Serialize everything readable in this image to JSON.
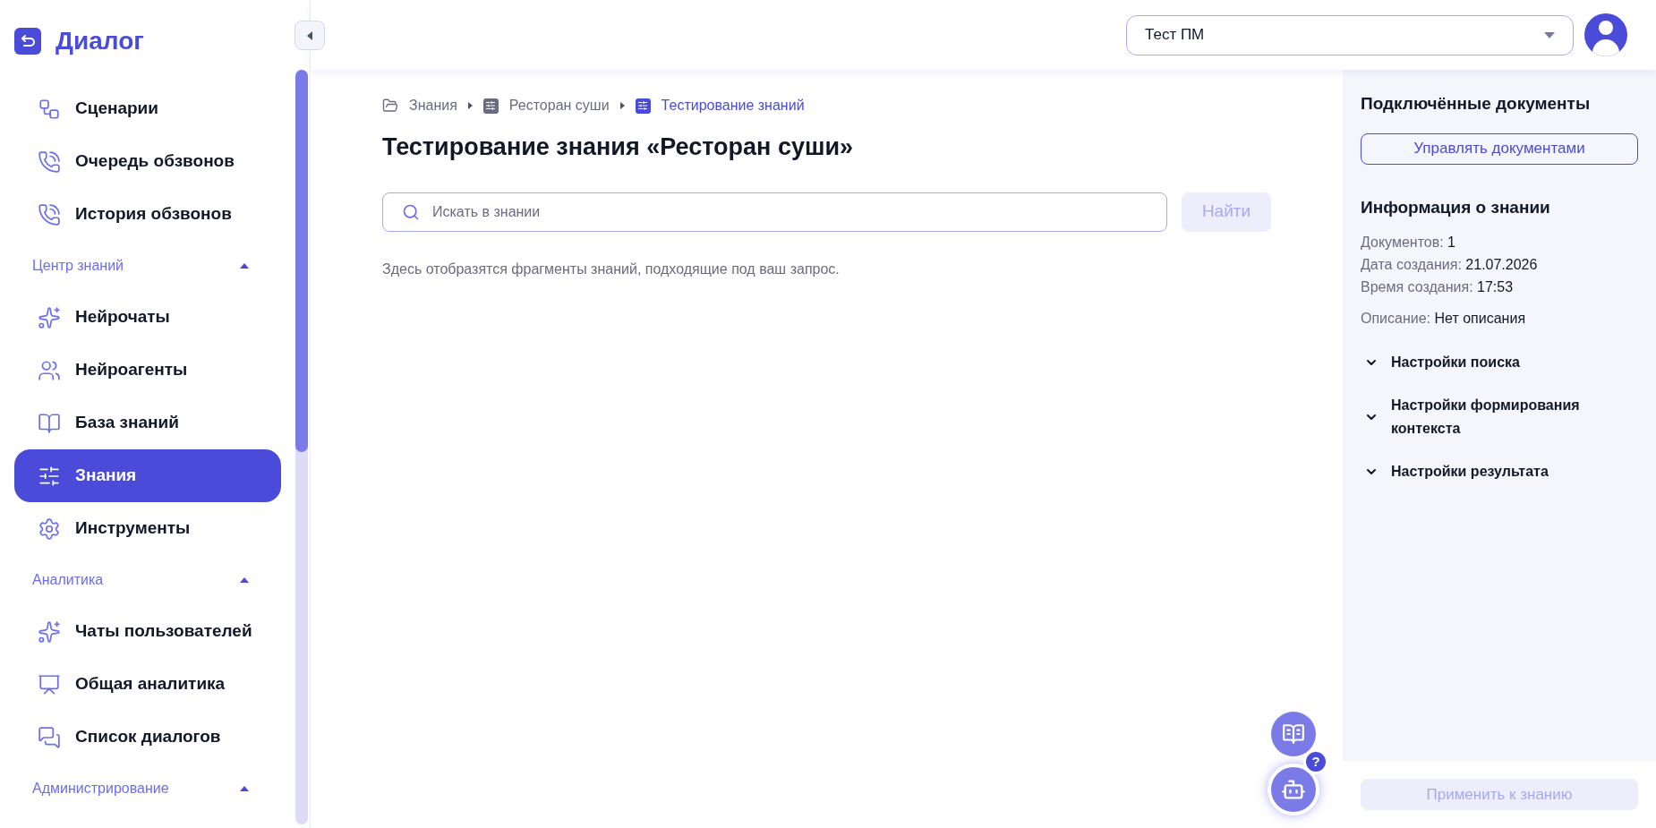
{
  "logo": {
    "text": "Диалог"
  },
  "sidebar": {
    "items": [
      {
        "kind": "item",
        "label": "Сценарии",
        "selected": false
      },
      {
        "kind": "item",
        "label": "Очередь обзвонов",
        "selected": false
      },
      {
        "kind": "item",
        "label": "История обзвонов",
        "selected": false
      },
      {
        "kind": "header",
        "label": "Центр знаний",
        "expanded": true
      },
      {
        "kind": "item",
        "label": "Нейрочаты",
        "selected": false
      },
      {
        "kind": "item",
        "label": "Нейроагенты",
        "selected": false
      },
      {
        "kind": "item",
        "label": "База знаний",
        "selected": false
      },
      {
        "kind": "item",
        "label": "Знания",
        "selected": true
      },
      {
        "kind": "item",
        "label": "Инструменты",
        "selected": false
      },
      {
        "kind": "header",
        "label": "Аналитика",
        "expanded": true
      },
      {
        "kind": "item",
        "label": "Чаты пользователей",
        "selected": false
      },
      {
        "kind": "item",
        "label": "Общая аналитика",
        "selected": false
      },
      {
        "kind": "item",
        "label": "Список диалогов",
        "selected": false
      },
      {
        "kind": "header",
        "label": "Администрирование",
        "expanded": true
      }
    ]
  },
  "header": {
    "project_select": {
      "value": "Тест ПМ"
    }
  },
  "breadcrumbs": [
    {
      "label": "Знания",
      "selected": false
    },
    {
      "label": "Ресторан суши",
      "selected": false
    },
    {
      "label": "Тестирование знаний",
      "selected": true
    }
  ],
  "page_title": "Тестирование знания «Ресторан суши»",
  "search": {
    "placeholder": "Искать в знании",
    "button": {
      "label": "Найти",
      "disabled": true
    }
  },
  "hint": "Здесь отобразятся фрагменты знаний, подходящие под ваш запрос.",
  "right_panel": {
    "documents_title": "Подключённые документы",
    "manage_button": "Управлять документами",
    "info_title": "Информация о знании",
    "info": [
      {
        "label": "Документов:",
        "value": "1"
      },
      {
        "label": "Дата создания:",
        "value": "21.07.2026"
      },
      {
        "label": "Время создания:",
        "value": "17:53"
      },
      {
        "label": "Описание:",
        "value": "Нет описания"
      }
    ],
    "sections": [
      {
        "label": "Настройки поиска",
        "expanded": false
      },
      {
        "label": "Настройки формирования контекста",
        "expanded": false
      },
      {
        "label": "Настройки результата",
        "expanded": false
      }
    ],
    "apply_button": {
      "label": "Применить к знанию",
      "disabled": true
    }
  },
  "help_badge": "?"
}
